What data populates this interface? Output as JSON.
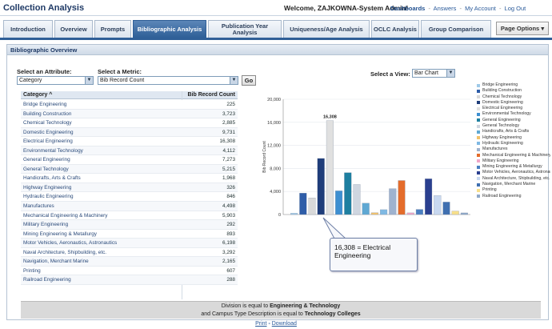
{
  "header": {
    "title": "Collection Analysis",
    "welcome": "Welcome, ZAJKOWNA-System Admin!",
    "links": [
      "Dashboards",
      "Answers",
      "My Account",
      "Log Out"
    ],
    "separator": "-"
  },
  "tabs": [
    {
      "label": "Introduction",
      "active": false
    },
    {
      "label": "Overview",
      "active": false
    },
    {
      "label": "Prompts",
      "active": false
    },
    {
      "label": "Bibliographic Analysis",
      "active": true
    },
    {
      "label": "Publication Year Analysis",
      "active": false
    },
    {
      "label": "Uniqueness/Age Analysis",
      "active": false
    },
    {
      "label": "OCLC Analysis",
      "active": false
    },
    {
      "label": "Group Comparison",
      "active": false
    }
  ],
  "page_options_label": "Page Options",
  "panel": {
    "title": "Bibliographic Overview",
    "attribute_label": "Select an Attribute:",
    "attribute_value": "Category",
    "metric_label": "Select a Metric:",
    "metric_value": "Bib Record Count",
    "go_label": "Go",
    "view_label": "Select a View:",
    "view_value": "Bar Chart"
  },
  "table": {
    "columns": [
      "Category",
      "Bib Record Count"
    ],
    "sort_indicator": "^",
    "rows": [
      {
        "category": "Bridge Engineering",
        "count": "225"
      },
      {
        "category": "Building Construction",
        "count": "3,723"
      },
      {
        "category": "Chemical Technology",
        "count": "2,885"
      },
      {
        "category": "Domestic Engineering",
        "count": "9,731"
      },
      {
        "category": "Electrical Engineering",
        "count": "16,308"
      },
      {
        "category": "Environmental Technology",
        "count": "4,112"
      },
      {
        "category": "General Engineering",
        "count": "7,273"
      },
      {
        "category": "General Technology",
        "count": "5,215"
      },
      {
        "category": "Handicrafts, Arts & Crafts",
        "count": "1,968"
      },
      {
        "category": "Highway Engineering",
        "count": "326"
      },
      {
        "category": "Hydraulic Engineering",
        "count": "846"
      },
      {
        "category": "Manufactures",
        "count": "4,498"
      },
      {
        "category": "Mechanical Engineering & Machinery",
        "count": "5,903"
      },
      {
        "category": "Military Engineering",
        "count": "292"
      },
      {
        "category": "Mining Engineering & Metallurgy",
        "count": "893"
      },
      {
        "category": "Motor Vehicles, Aeronautics, Astronautics",
        "count": "6,198"
      },
      {
        "category": "Naval Architecture, Shipbuilding, etc.",
        "count": "3,292"
      },
      {
        "category": "Navigation, Merchant Marine",
        "count": "2,165"
      },
      {
        "category": "Printing",
        "count": "607"
      },
      {
        "category": "Railroad Engineering",
        "count": "288"
      }
    ]
  },
  "filter": {
    "line1_prefix": "Division is equal to",
    "line1_value": "Engineering & Technology",
    "line2_prefix": "and Campus Type Description is equal to",
    "line2_value": "Technology Colleges"
  },
  "footer_links": [
    "Print",
    "Download"
  ],
  "footer_separator": "-",
  "callout": {
    "text": "16,308 = Electrical Engineering"
  },
  "chart_data": {
    "type": "bar",
    "ylabel": "Bib Record Count",
    "ylim": [
      0,
      20000
    ],
    "yticks": [
      "0",
      "4,000",
      "8,000",
      "12,000",
      "16,000",
      "20,000"
    ],
    "data_label": "16,308",
    "categories": [
      "Bridge Engineering",
      "Building Construction",
      "Chemical Technology",
      "Domestic Engineering",
      "Electrical Engineering",
      "Environmental Technology",
      "General Engineering",
      "General Technology",
      "Handicrafts, Arts & Crafts",
      "Highway Engineering",
      "Hydraulic Engineering",
      "Manufactures",
      "Mechanical Engineering & Machinery",
      "Military Engineering",
      "Mining Engineering & Metallurgy",
      "Motor Vehicles, Aeronautics, Astronautics",
      "Naval Architecture, Shipbuilding, etc.",
      "Navigation, Merchant Marine",
      "Printing",
      "Railroad Engineering"
    ],
    "values": [
      225,
      3723,
      2885,
      9731,
      16308,
      4112,
      7273,
      5215,
      1968,
      326,
      846,
      4498,
      5903,
      292,
      893,
      6198,
      3292,
      2165,
      607,
      288
    ],
    "colors": [
      "#9ec9e8",
      "#2e5da8",
      "#d9d9d9",
      "#1f3d7a",
      "#e0e0e0",
      "#3d8fd1",
      "#1e7fa0",
      "#cfd6e0",
      "#5fa8d3",
      "#f3c26b",
      "#7fb9e3",
      "#9fb3cf",
      "#e46c2b",
      "#f0a6c8",
      "#4a7fc1",
      "#2a3f8f",
      "#c8d8f0",
      "#3f6fb0",
      "#f7df8a",
      "#8fa8c8"
    ]
  }
}
